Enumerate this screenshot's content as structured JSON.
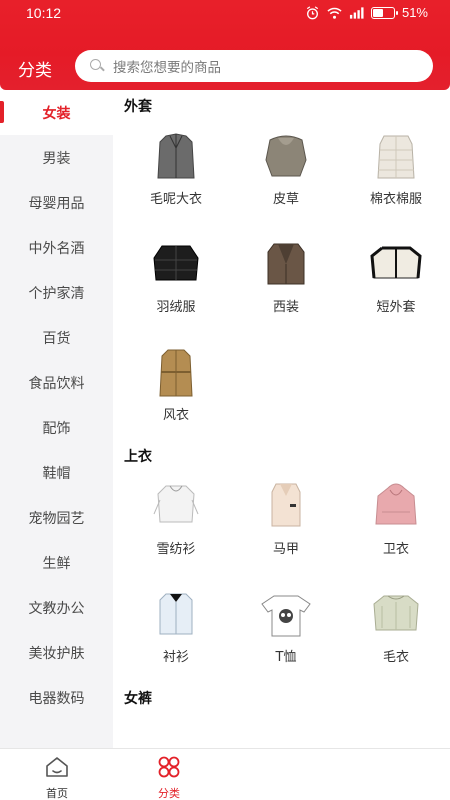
{
  "status": {
    "time": "10:12",
    "battery": "51%",
    "battery_level": 0.51
  },
  "header": {
    "title": "分类",
    "search_placeholder": "搜索您想要的商品"
  },
  "sidebar": {
    "items": [
      {
        "label": "女装",
        "active": true
      },
      {
        "label": "男装"
      },
      {
        "label": "母婴用品"
      },
      {
        "label": "中外名酒"
      },
      {
        "label": "个护家清"
      },
      {
        "label": "百货"
      },
      {
        "label": "食品饮料"
      },
      {
        "label": "配饰"
      },
      {
        "label": "鞋帽"
      },
      {
        "label": "宠物园艺"
      },
      {
        "label": "生鲜"
      },
      {
        "label": "文教办公"
      },
      {
        "label": "美妆护肤"
      },
      {
        "label": "电器数码"
      }
    ]
  },
  "sections": [
    {
      "title": "外套",
      "items": [
        {
          "label": "毛呢大衣",
          "icon": "coat-icon",
          "color": "#6b6b6b"
        },
        {
          "label": "皮草",
          "icon": "fur-icon",
          "color": "#8c8577"
        },
        {
          "label": "棉衣棉服",
          "icon": "padded-jacket-icon",
          "color": "#ece7de"
        },
        {
          "label": "羽绒服",
          "icon": "down-jacket-icon",
          "color": "#1d1d1d"
        },
        {
          "label": "西装",
          "icon": "blazer-icon",
          "color": "#6a5646"
        },
        {
          "label": "短外套",
          "icon": "short-jacket-icon",
          "color": "#f0ece2"
        },
        {
          "label": "风衣",
          "icon": "trench-coat-icon",
          "color": "#b48d52"
        }
      ]
    },
    {
      "title": "上衣",
      "items": [
        {
          "label": "雪纺衫",
          "icon": "chiffon-shirt-icon",
          "color": "#f3f3f3"
        },
        {
          "label": "马甲",
          "icon": "vest-icon",
          "color": "#f3e2d3"
        },
        {
          "label": "卫衣",
          "icon": "hoodie-icon",
          "color": "#e8a9ad"
        },
        {
          "label": "衬衫",
          "icon": "shirt-icon",
          "color": "#e6eef6"
        },
        {
          "label": "T恤",
          "icon": "tshirt-icon",
          "color": "#ffffff"
        },
        {
          "label": "毛衣",
          "icon": "sweater-icon",
          "color": "#d8dcc6"
        }
      ]
    },
    {
      "title": "女裤",
      "items": []
    }
  ],
  "tabbar": {
    "items": [
      {
        "label": "首页",
        "icon": "home-icon",
        "active": false
      },
      {
        "label": "分类",
        "icon": "category-icon",
        "active": true
      }
    ]
  },
  "colors": {
    "brand": "#e32129",
    "sidebar_bg": "#f4f4f6",
    "inactive_text": "#4a4a4a"
  }
}
